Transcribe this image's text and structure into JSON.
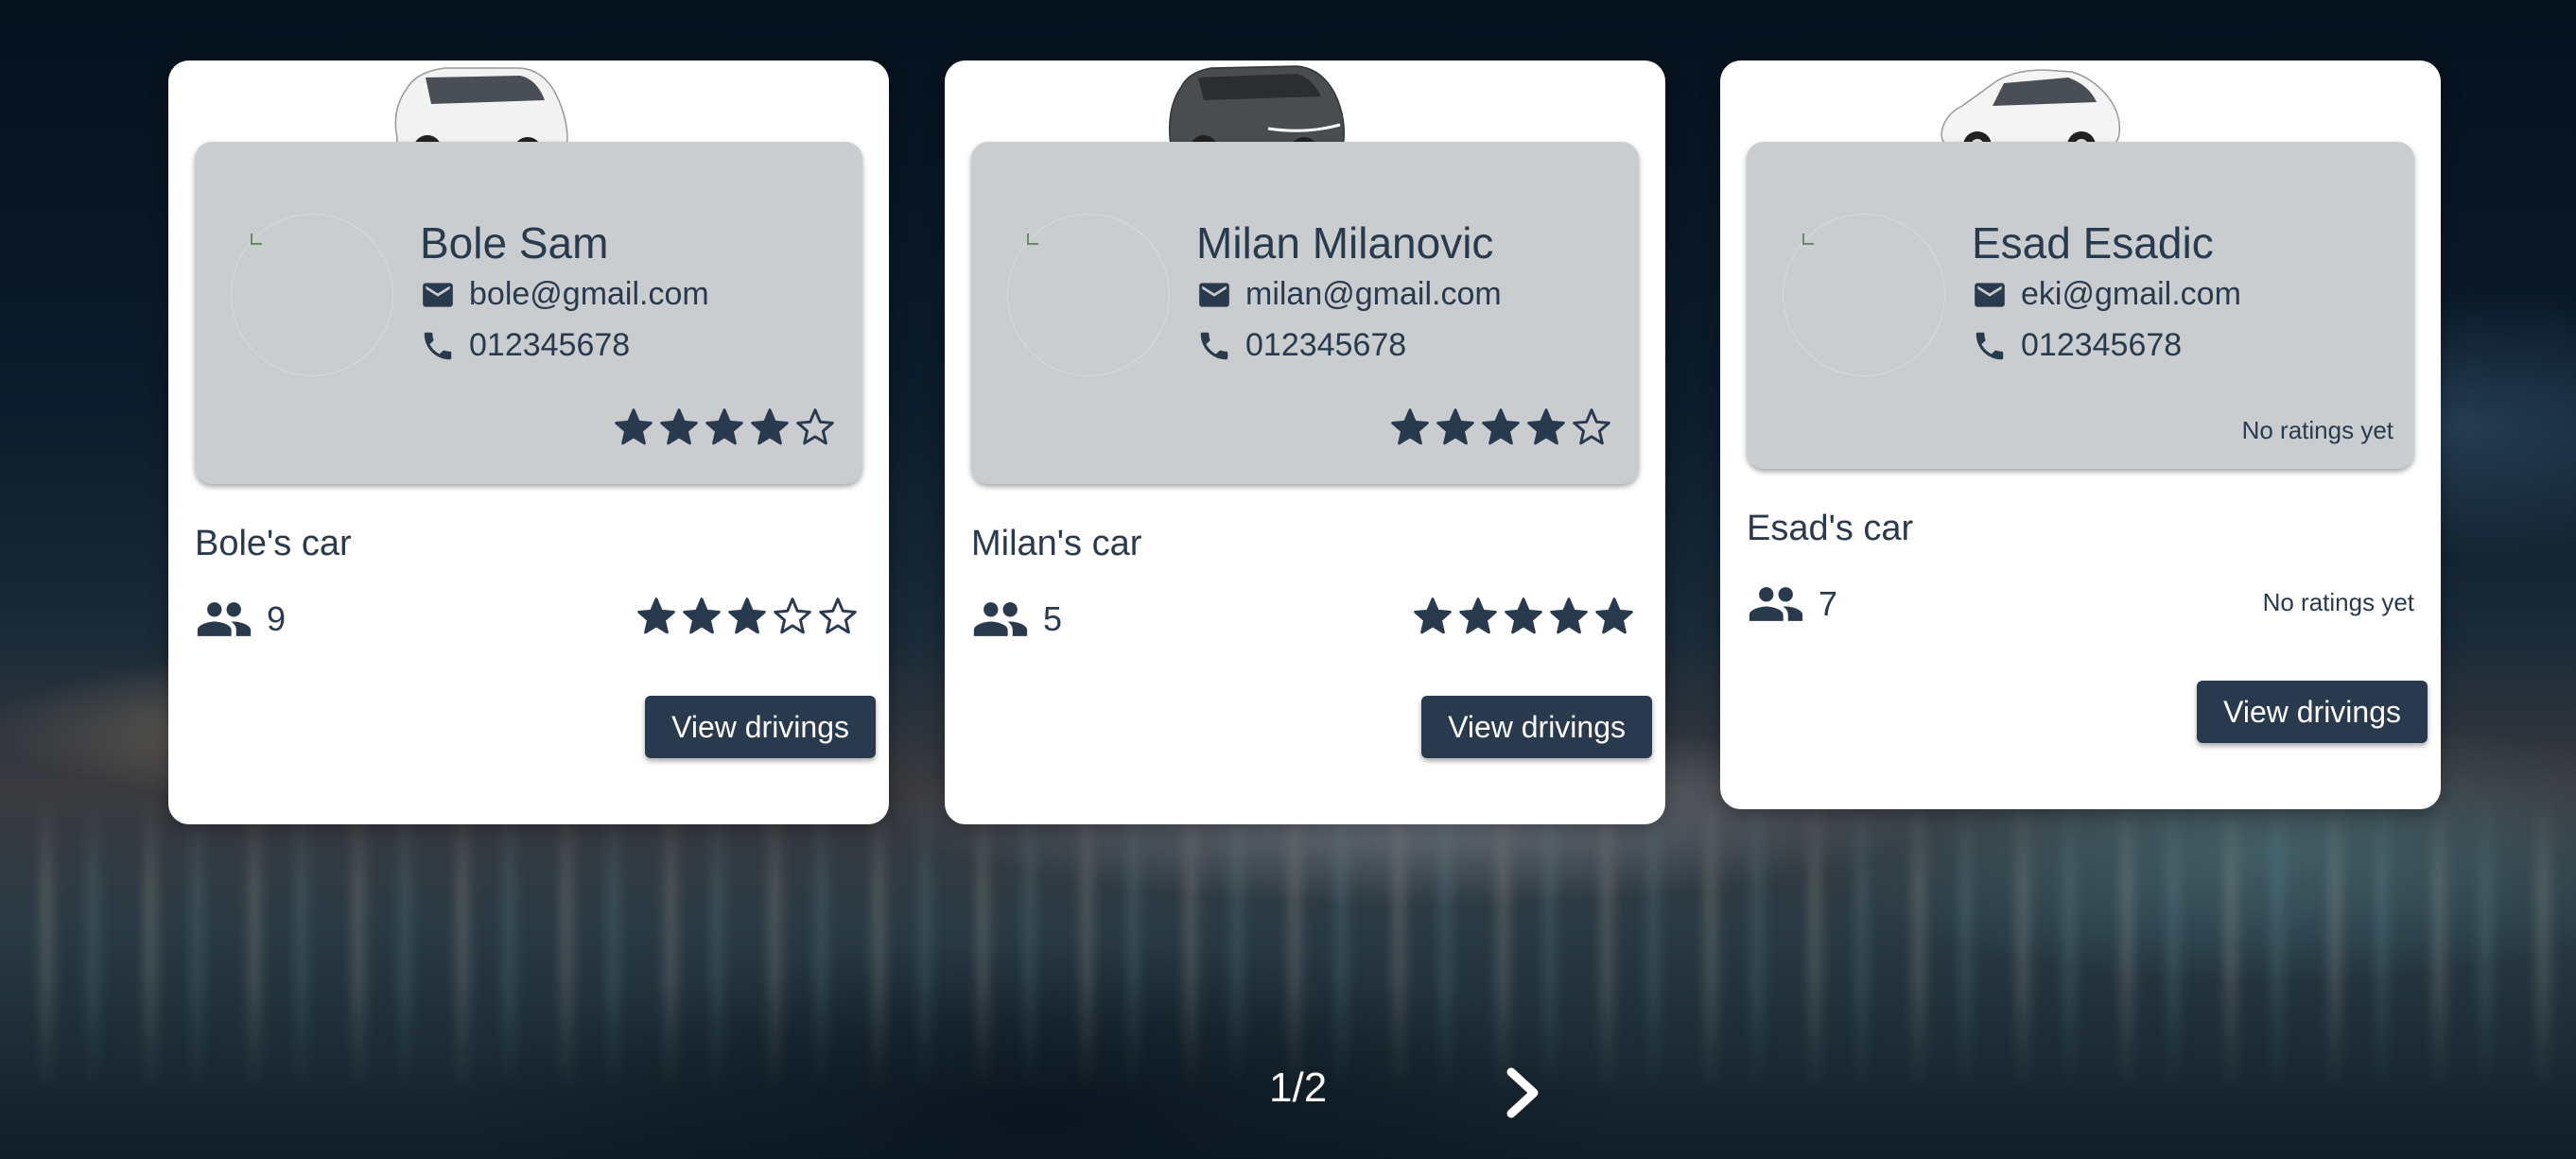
{
  "cards": [
    {
      "driver": {
        "name": "Bole Sam",
        "email": "bole@gmail.com",
        "phone": "012345678",
        "rating": 4,
        "rating_text": ""
      },
      "car": {
        "name": "Bole's car",
        "seats": "9",
        "rating": 3,
        "rating_text": "",
        "color": "#f2f2f2"
      },
      "button_label": "View drivings"
    },
    {
      "driver": {
        "name": "Milan Milanovic",
        "email": "milan@gmail.com",
        "phone": "012345678",
        "rating": 4,
        "rating_text": ""
      },
      "car": {
        "name": "Milan's car",
        "seats": "5",
        "rating": 5,
        "rating_text": "",
        "color": "#4a4d50"
      },
      "button_label": "View drivings"
    },
    {
      "driver": {
        "name": "Esad Esadic",
        "email": "eki@gmail.com",
        "phone": "012345678",
        "rating": null,
        "rating_text": "No ratings yet"
      },
      "car": {
        "name": "Esad's car",
        "seats": "7",
        "rating": null,
        "rating_text": "No ratings yet",
        "color": "#f4f4f4"
      },
      "button_label": "View drivings"
    }
  ],
  "pagination": {
    "label": "1/2"
  },
  "icons": {
    "email": "mail-icon",
    "phone": "phone-icon",
    "seats": "people-icon",
    "next": "chevron-right-icon",
    "star": "star-icon"
  },
  "colors": {
    "accent": "#2a3a4e",
    "panel": "#cacdd0"
  }
}
